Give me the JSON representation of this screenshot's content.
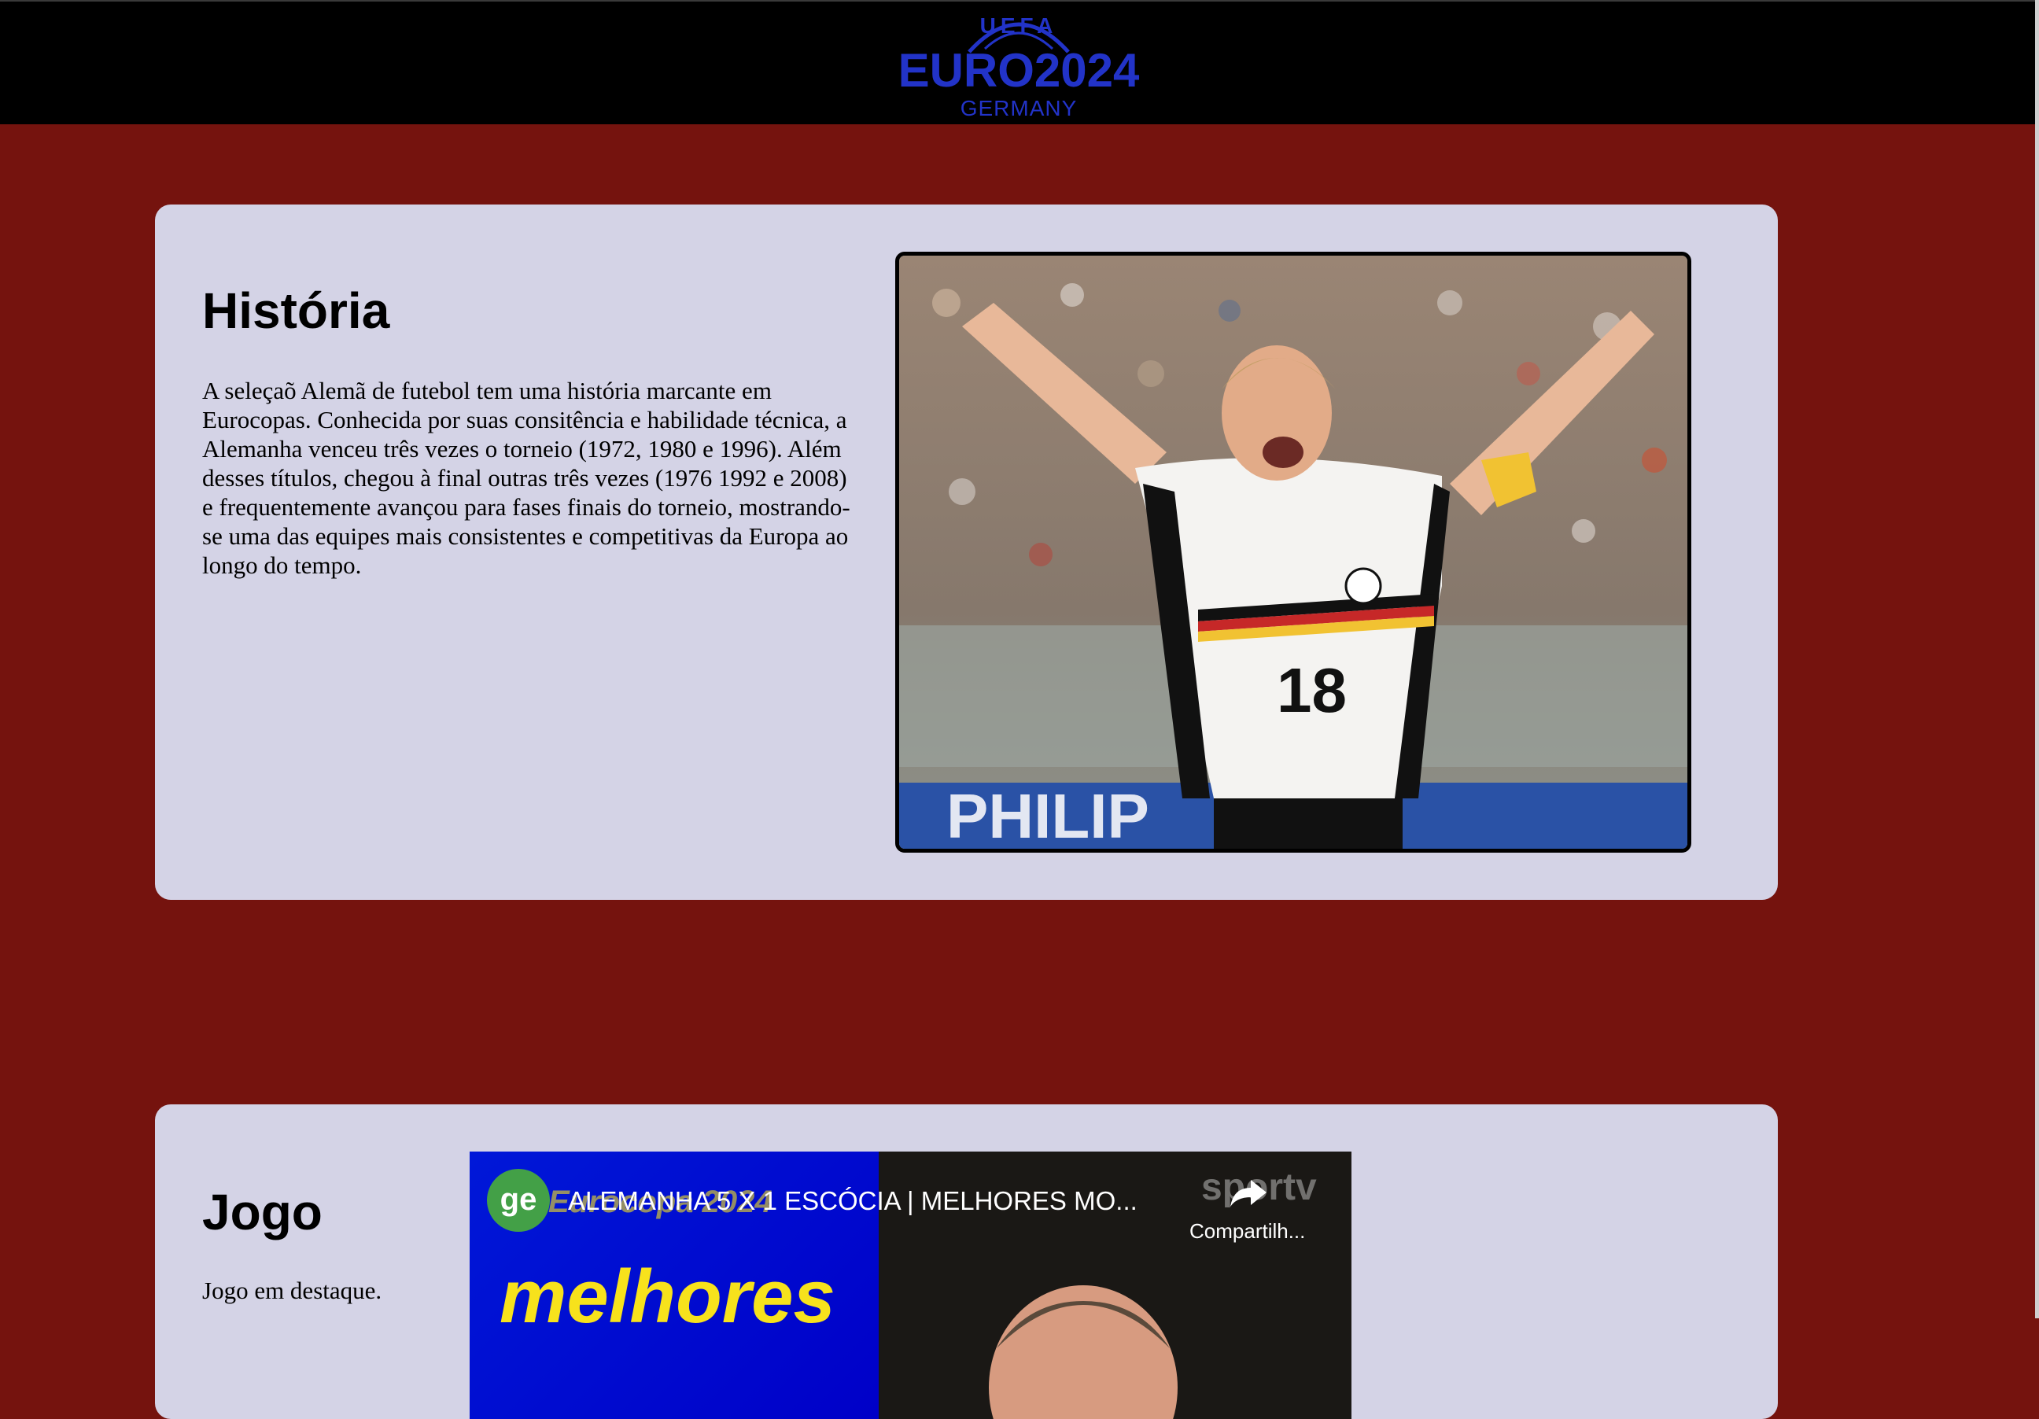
{
  "header": {
    "logo": {
      "top_text": "UEFA",
      "main_text": "EURO2024",
      "sub_text": "GERMANY",
      "color": "#2233c8"
    }
  },
  "history": {
    "title": "História",
    "paragraph": "A seleçaõ Alemã de futebol tem uma história marcante em Eurocopas. Conhecida por suas consitência e habilidade técnica, a Alemanha venceu três vezes o torneio (1972, 1980 e 1996). Além desses títulos, chegou à final outras três vezes (1976 1992 e 2008) e frequentemente avançou para fases finais do torneio, mostrando-se uma das equipes mais consistentes e competitivas da Europa ao longo do tempo.",
    "image": {
      "jersey_number": "18",
      "banner_text": "PHILIP"
    }
  },
  "game": {
    "title": "Jogo",
    "paragraph": "Jogo em destaque.",
    "video": {
      "channel_badge": "ge",
      "title": "ALEMANHA 5 X 1 ESCÓCIA | MELHORES MO...",
      "share_label": "Compartilh...",
      "channel_logo": "sportv",
      "thumbnail_text": "melhores",
      "thumbnail_small": "Eurocopa 2024"
    }
  },
  "colors": {
    "page_background": "#75130e",
    "card_background": "#d4d3e6",
    "header_background": "#000000",
    "logo_blue": "#2233c8"
  }
}
